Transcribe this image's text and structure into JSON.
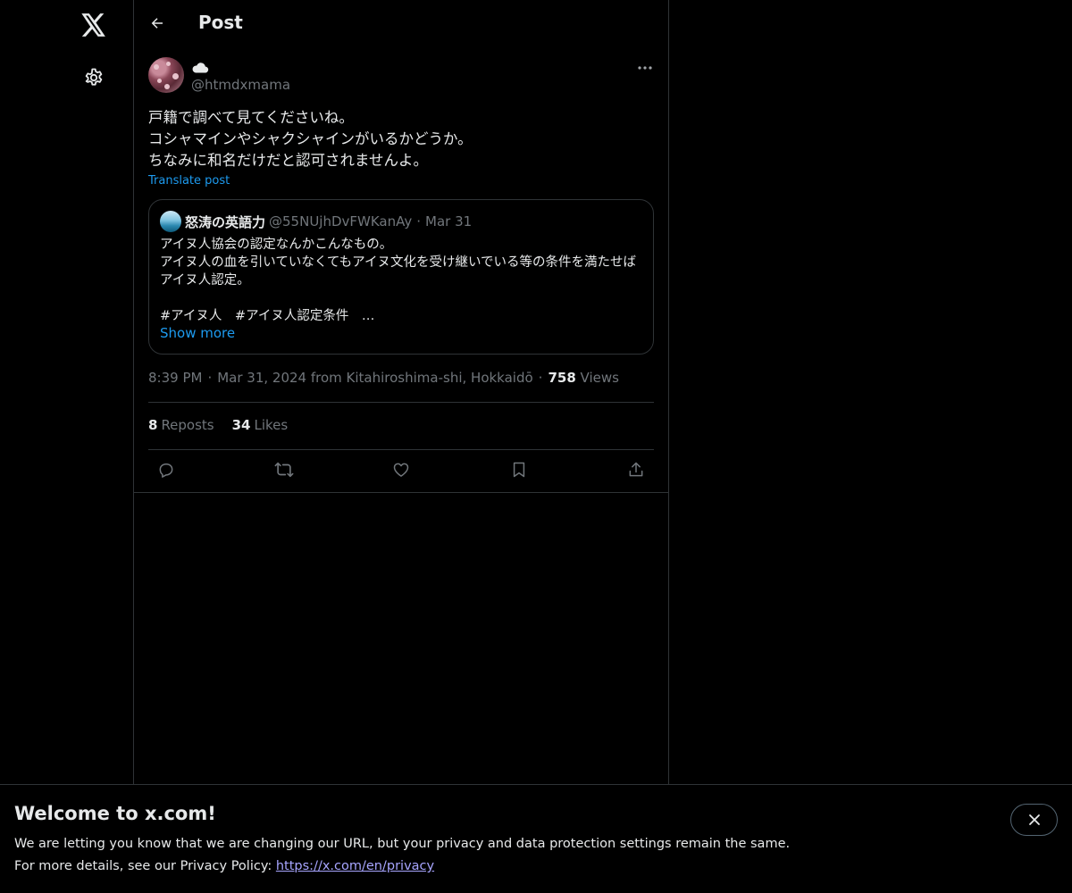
{
  "nav": {
    "logo_icon": "x-logo-icon",
    "settings_icon": "gear-icon"
  },
  "header": {
    "title": "Post"
  },
  "post": {
    "display_name_icon": "cloud-emoji",
    "handle": "@htmdxmama",
    "text": "戸籍で調べて見てくださいね。\nコシャマインやシャクシャインがいるかどうか。\nちなみに和名だけだと認可されませんよ。",
    "translate_label": "Translate post",
    "quote": {
      "name": "怒涛の英語力",
      "handle": "@55NUjhDvFWKanAy",
      "separator": "·",
      "date": "Mar 31",
      "text": "アイヌ人協会の認定なんかこんなもの。\nアイヌ人の血を引いていなくてもアイヌ文化を受け継いでいる等の条件を満たせばアイヌ人認定。\n\n#アイヌ人　#アイヌ人認定条件　…",
      "show_more": "Show more"
    },
    "meta": {
      "time": "8:39 PM",
      "date_location": "Mar 31, 2024 from Kitahiroshima-shi, Hokkaidō",
      "views_count": "758",
      "views_label": "Views",
      "separator": "·"
    },
    "stats": {
      "reposts_count": "8",
      "reposts_label": "Reposts",
      "likes_count": "34",
      "likes_label": "Likes"
    },
    "actions": [
      "reply-icon",
      "repost-icon",
      "like-icon",
      "bookmark-icon",
      "share-icon"
    ]
  },
  "banner": {
    "title": "Welcome to x.com!",
    "line1": "We are letting you know that we are changing our URL, but your privacy and data protection settings remain the same.",
    "line2_prefix": "For more details, see our Privacy Policy: ",
    "link": "https://x.com/en/privacy"
  },
  "colors": {
    "background": "#000000",
    "text": "#e7e9ea",
    "muted": "#71767b",
    "accent": "#1d9bf0",
    "border": "#2f3336",
    "link": "#a7a5ff"
  }
}
